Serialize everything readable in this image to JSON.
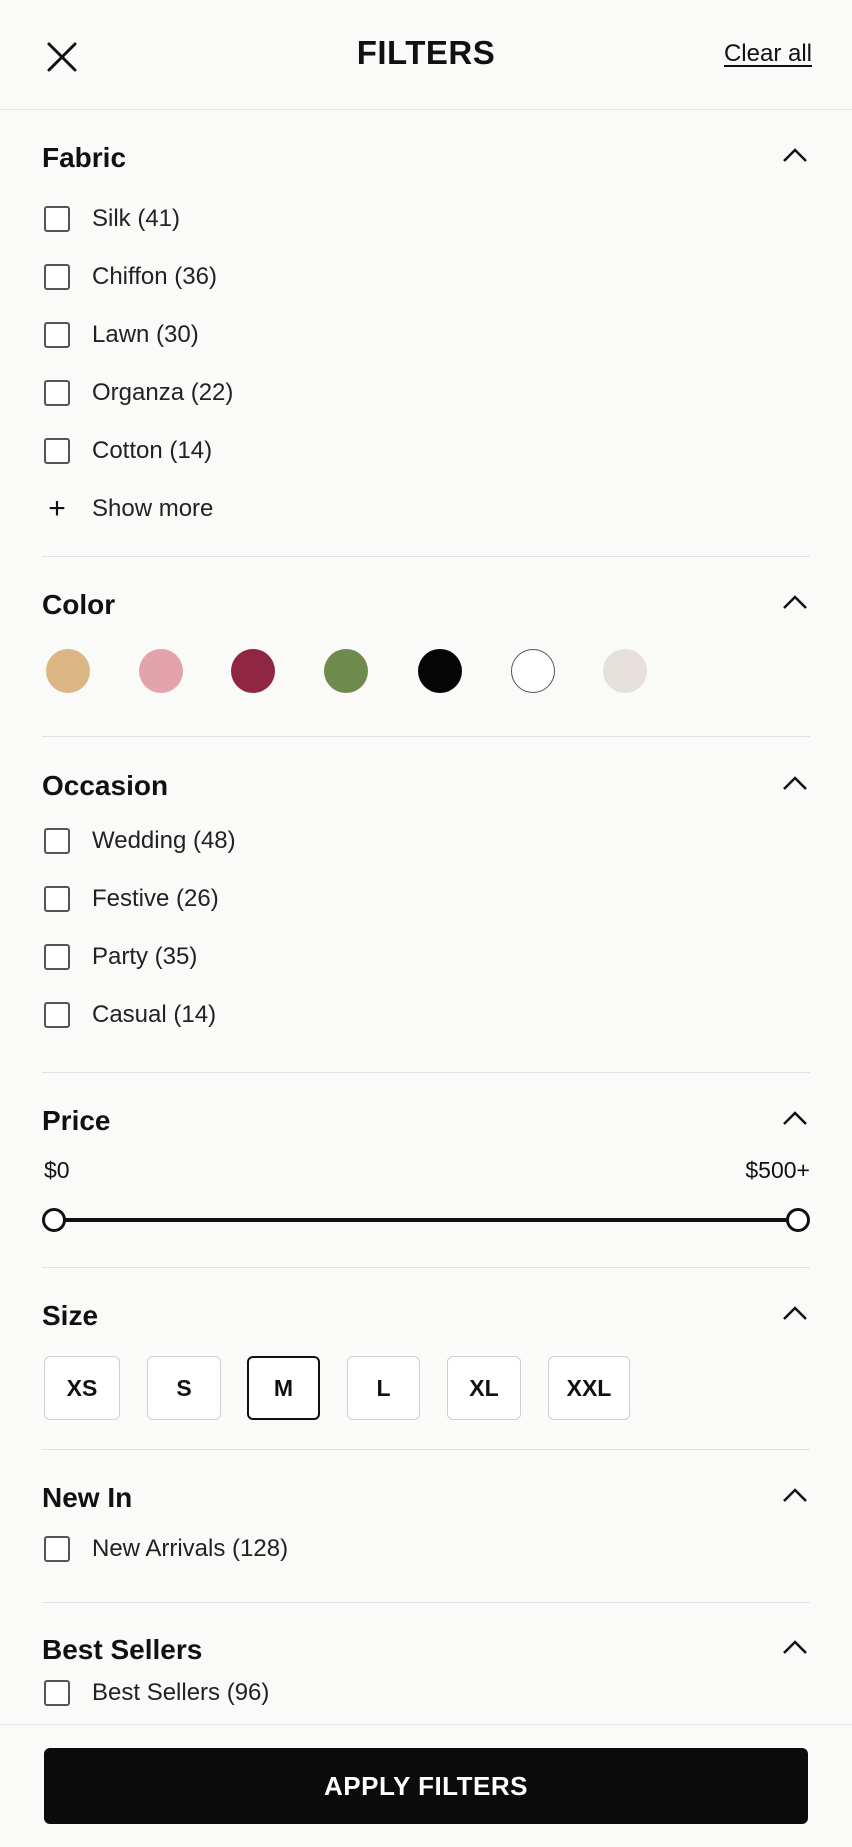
{
  "header": {
    "title": "FILTERS",
    "clear_all": "Clear all",
    "close_icon": "close-icon"
  },
  "fabric": {
    "title": "Fabric",
    "items": [
      "Silk (41)",
      "Chiffon (36)",
      "Lawn (30)",
      "Organza (22)",
      "Cotton (14)"
    ],
    "show_more": "Show more"
  },
  "color": {
    "title": "Color",
    "swatches": [
      "#dcb585",
      "#e2a4aa",
      "#8f2642",
      "#6f8a4d",
      "#050505",
      "#ffffff",
      "#e5e0dc"
    ]
  },
  "occasion": {
    "title": "Occasion",
    "items": [
      "Wedding (48)",
      "Festive (26)",
      "Party (35)",
      "Casual (14)"
    ]
  },
  "price": {
    "title": "Price",
    "min_label": "$0",
    "max_label": "$500+",
    "range_low": 0,
    "range_high": 1
  },
  "size": {
    "title": "Size",
    "options": [
      "XS",
      "S",
      "M",
      "L",
      "XL",
      "XXL"
    ],
    "selected": "M"
  },
  "new_in": {
    "title": "New In",
    "items": [
      "New Arrivals (128)"
    ]
  },
  "best_sellers": {
    "title": "Best Sellers",
    "items": [
      "Best Sellers (96)"
    ]
  },
  "footer": {
    "apply_label": "APPLY FILTERS"
  }
}
